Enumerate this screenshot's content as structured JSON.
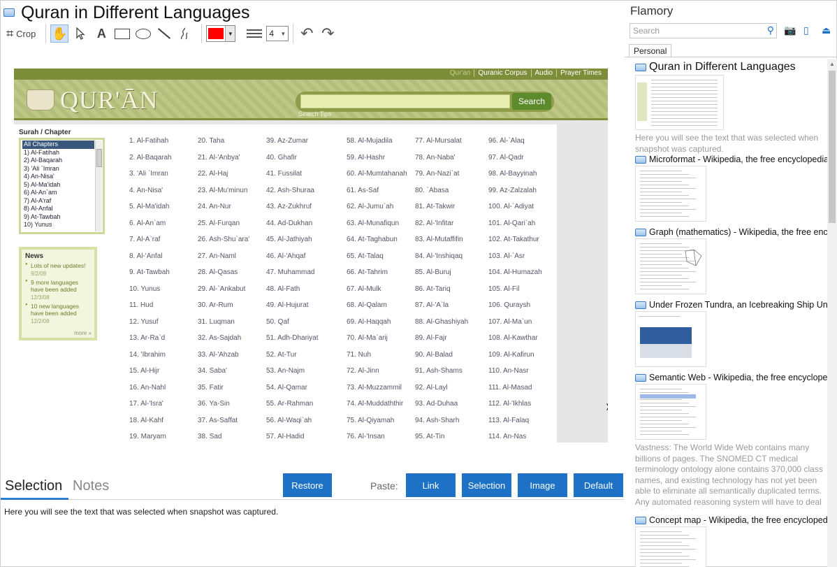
{
  "window": {
    "title": "Quran in Different Languages"
  },
  "toolbar": {
    "crop_label": "Crop",
    "line_width": "4",
    "color": "#ff0000"
  },
  "snapshot": {
    "nav": [
      "Qur'an",
      "Quranic Corpus",
      "Audio",
      "Prayer Times"
    ],
    "brand": "QUR'ĀN",
    "search_button": "Search",
    "search_tips": "Search Tips",
    "sidebar_label": "Surah / Chapter",
    "sidebar_items": [
      "All Chapters",
      "1) Al-Fatihah",
      "2) Al-Baqarah",
      "3) 'Ali `Imran",
      "4) An-Nisa'",
      "5) Al-Ma'idah",
      "6) Al-An`am",
      "7) Al-A'raf",
      "8) Al-Anfal",
      "9) At-Tawbah",
      "10) Yunus"
    ],
    "news": {
      "title": "News",
      "items": [
        {
          "text": "Lots of new updates!",
          "date": "9/2/09"
        },
        {
          "text": "9 more languages have been added",
          "date": "12/3/08"
        },
        {
          "text": "10 new languages have been added",
          "date": "12/2/08"
        }
      ],
      "more": "more »"
    },
    "chapters": [
      [
        "1. Al-Fatihah",
        "2. Al-Baqarah",
        "3. 'Ali `Imran",
        "4. An-Nisa'",
        "5. Al-Ma'idah",
        "6. Al-An`am",
        "7. Al-A`raf",
        "8. Al-'Anfal",
        "9. At-Tawbah",
        "10. Yunus",
        "11. Hud",
        "12. Yusuf",
        "13. Ar-Ra`d",
        "14. 'Ibrahim",
        "15. Al-Hijr",
        "16. An-Nahl",
        "17. Al-'Isra'",
        "18. Al-Kahf",
        "19. Maryam"
      ],
      [
        "20. Taha",
        "21. Al-'Anbya'",
        "22. Al-Haj",
        "23. Al-Mu'minun",
        "24. An-Nur",
        "25. Al-Furqan",
        "26. Ash-Shu`ara'",
        "27. An-Naml",
        "28. Al-Qasas",
        "29. Al-`Ankabut",
        "30. Ar-Rum",
        "31. Luqman",
        "32. As-Sajdah",
        "33. Al-'Ahzab",
        "34. Saba'",
        "35. Fatir",
        "36. Ya-Sin",
        "37. As-Saffat",
        "38. Sad"
      ],
      [
        "39. Az-Zumar",
        "40. Ghafir",
        "41. Fussilat",
        "42. Ash-Shuraa",
        "43. Az-Zukhruf",
        "44. Ad-Dukhan",
        "45. Al-Jathiyah",
        "46. Al-'Ahqaf",
        "47. Muhammad",
        "48. Al-Fath",
        "49. Al-Hujurat",
        "50. Qaf",
        "51. Adh-Dhariyat",
        "52. At-Tur",
        "53. An-Najm",
        "54. Al-Qamar",
        "55. Ar-Rahman",
        "56. Al-Waqi`ah",
        "57. Al-Hadid"
      ],
      [
        "58. Al-Mujadila",
        "59. Al-Hashr",
        "60. Al-Mumtahanah",
        "61. As-Saf",
        "62. Al-Jumu`ah",
        "63. Al-Munafiqun",
        "64. At-Taghabun",
        "65. At-Talaq",
        "66. At-Tahrim",
        "67. Al-Mulk",
        "68. Al-Qalam",
        "69. Al-Haqqah",
        "70. Al-Ma`arij",
        "71. Nuh",
        "72. Al-Jinn",
        "73. Al-Muzzammil",
        "74. Al-Muddaththir",
        "75. Al-Qiyamah",
        "76. Al-'Insan"
      ],
      [
        "77. Al-Mursalat",
        "78. An-Naba'",
        "79. An-Nazi`at",
        "80. `Abasa",
        "81. At-Takwir",
        "82. Al-'Infitar",
        "83. Al-Mutaffifin",
        "84. Al-'Inshiqaq",
        "85. Al-Buruj",
        "86. At-Tariq",
        "87. Al-'A`la",
        "88. Al-Ghashiyah",
        "89. Al-Fajr",
        "90. Al-Balad",
        "91. Ash-Shams",
        "92. Al-Layl",
        "93. Ad-Duhaa",
        "94. Ash-Sharh",
        "95. At-Tin"
      ],
      [
        "96. Al-`Alaq",
        "97. Al-Qadr",
        "98. Al-Bayyinah",
        "99. Az-Zalzalah",
        "100. Al-`Adiyat",
        "101. Al-Qari`ah",
        "102. At-Takathur",
        "103. Al-`Asr",
        "104. Al-Humazah",
        "105. Al-Fil",
        "106. Quraysh",
        "107. Al-Ma`un",
        "108. Al-Kawthar",
        "109. Al-Kafirun",
        "110. An-Nasr",
        "111. Al-Masad",
        "112. Al-'Ikhlas",
        "113. Al-Falaq",
        "114. An-Nas"
      ]
    ]
  },
  "bottom": {
    "tab_selection": "Selection",
    "tab_notes": "Notes",
    "restore": "Restore",
    "paste_label": "Paste:",
    "link": "Link",
    "selection": "Selection",
    "image": "Image",
    "default": "Default",
    "selected_text": "Here you will see the text that was selected when snapshot was captured."
  },
  "sidebar": {
    "app_name": "Flamory",
    "search_placeholder": "Search",
    "tab_personal": "Personal",
    "items": [
      {
        "title": "Quran in Different Languages",
        "desc": "Here you will see the text that was selected when snapshot was captured."
      },
      {
        "title": "Microformat - Wikipedia, the free encyclopedia",
        "desc": ""
      },
      {
        "title": "Graph (mathematics) - Wikipedia, the free encyclopedia",
        "desc": ""
      },
      {
        "title": "Under Frozen Tundra, an Icebreaking Ship Uncovers",
        "desc": ""
      },
      {
        "title": "Semantic Web - Wikipedia, the free encyclopedia",
        "desc": "Vastness: The World Wide Web contains many billions of pages. The SNOMED CT medical terminology ontology alone contains 370,000 class names, and existing technology has not yet been able to eliminate all semantically duplicated terms. Any automated reasoning system will have to deal with truly huge inputs."
      },
      {
        "title": "Concept map - Wikipedia, the free encyclopedia",
        "desc": ""
      }
    ]
  }
}
